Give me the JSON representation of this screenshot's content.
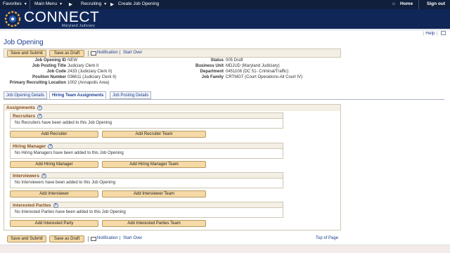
{
  "topnav": {
    "favorites": "Favorites",
    "main_menu": "Main Menu",
    "breadcrumb_1": "Recruiting",
    "breadcrumb_2": "Create Job Opening",
    "home": "Home",
    "sign_out": "Sign out"
  },
  "banner": {
    "brand": "CONNECT",
    "sub": "Maryland Judiciary"
  },
  "helpbar": {
    "help": "Help"
  },
  "page": {
    "title": "Job Opening"
  },
  "toolbar": {
    "save_submit": "Save and Submit",
    "save_draft": "Save as Draft",
    "notification": "Notification",
    "start_over": "Start Over",
    "top_of_page": "Top of Page"
  },
  "info": {
    "left": [
      {
        "label": "Job Opening ID",
        "value": "NEW"
      },
      {
        "label": "Job Posting Title",
        "value": "Judiciary Clerk II"
      },
      {
        "label": "Job Code",
        "value": "2433 (Judiciary Clerk II)"
      },
      {
        "label": "Position Number",
        "value": "036611 (Judiciary Clerk II)"
      },
      {
        "label": "Primary Recruiting Location",
        "value": "1002 (Annapolis Area)"
      }
    ],
    "right": [
      {
        "label": "Status",
        "value": "005 Draft"
      },
      {
        "label": "Business Unit",
        "value": "MDJUD (Maryland Judiciary)"
      },
      {
        "label": "Department",
        "value": "0451108 (DC 51- Criminal/Traffic)"
      },
      {
        "label": "Job Family",
        "value": "CRTMGT (Court Operations-All Court IV)"
      }
    ]
  },
  "tabs": [
    "Job Opening Details",
    "Hiring Team Assignments",
    "Job Posting Details"
  ],
  "assignments": {
    "title": "Assignments",
    "sections": [
      {
        "title": "Recruiters",
        "empty": "No Recruiters have been added to this Job Opening",
        "add": "Add Recruiter",
        "add_team": "Add Recruiter Team"
      },
      {
        "title": "Hiring Manager",
        "empty": "No Hiring Managers have been added to this Job Opening",
        "add": "Add Hiring Manager",
        "add_team": "Add Hiring Manager Team"
      },
      {
        "title": "Interviewers",
        "empty": "No Interviewers have been added to this Job Opening",
        "add": "Add Interviewer",
        "add_team": "Add Interviewer Team"
      },
      {
        "title": "Interested Parties",
        "empty": "No Interested Parties have been added to this Job Opening",
        "add": "Add Interested Party",
        "add_team": "Add Interested Parties Team"
      }
    ]
  },
  "colors": {
    "nav_bg": "#101f3b",
    "banner_bg": "#0f2657",
    "button_bg": "#f5d9a6",
    "section_title": "#8a4a14",
    "link": "#1a3c8f"
  }
}
